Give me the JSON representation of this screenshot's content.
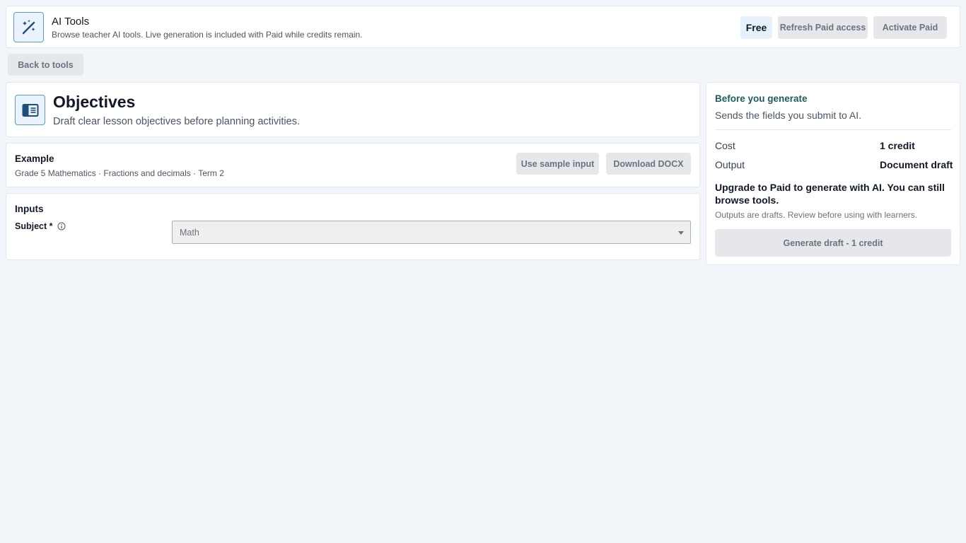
{
  "header": {
    "app_title": "AI Tools",
    "app_subtitle": "Browse teacher AI tools. Live generation is included with Paid while credits remain.",
    "app_icon": "magic-wand-icon",
    "plan_badge": "Free",
    "refresh_label": "Refresh Paid access",
    "activate_label": "Activate Paid"
  },
  "nav": {
    "back_label": "Back to tools"
  },
  "tool": {
    "icon": "book-panel-icon",
    "title": "Objectives",
    "description": "Draft clear lesson objectives before planning activities."
  },
  "example": {
    "label": "Example",
    "text": "Grade 5 Mathematics · Fractions and decimals · Term 2",
    "sample_label": "Use sample input",
    "download_label": "Download DOCX"
  },
  "inputs": {
    "label": "Inputs",
    "subject_label": "Subject *",
    "subject_value": "Math"
  },
  "summary": {
    "title": "Before you generate",
    "subtitle": "Sends the fields you submit to AI.",
    "cost_label": "Cost",
    "cost_value": "1 credit",
    "output_label": "Output",
    "output_value": "Document draft",
    "upgrade_text": "Upgrade to Paid to generate with AI. You can still browse tools.",
    "draft_note": "Outputs are drafts. Review before using with learners.",
    "generate_label": "Generate draft - 1 credit"
  },
  "colors": {
    "accent": "#1b5e58",
    "icon_border": "#5b9cc9",
    "icon_fill": "#eaf3fb",
    "background": "#f2f5f9"
  }
}
